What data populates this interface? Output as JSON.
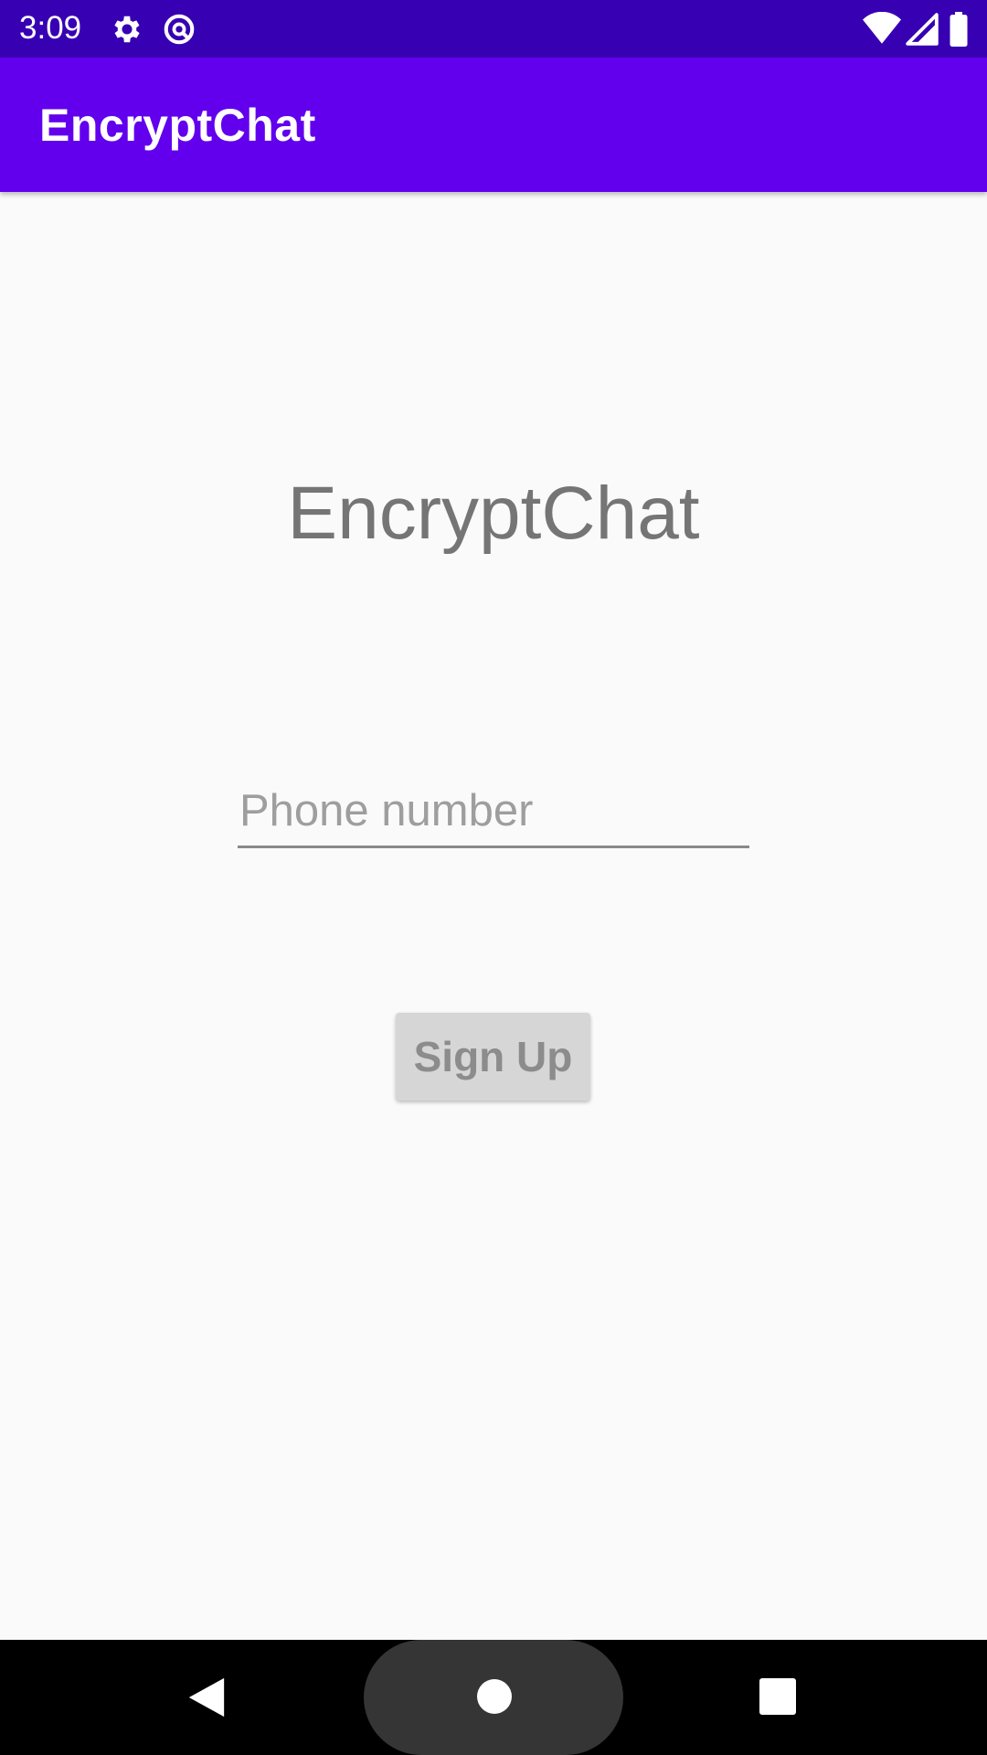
{
  "status_bar": {
    "time": "3:09",
    "icons": [
      "settings-icon",
      "sync-icon",
      "wifi-icon",
      "signal-icon",
      "battery-icon"
    ]
  },
  "app_bar": {
    "title": "EncryptChat",
    "color": "#6200EE"
  },
  "main": {
    "title": "EncryptChat",
    "phone_input": {
      "placeholder": "Phone number",
      "value": ""
    },
    "signup_button_label": "Sign Up"
  },
  "nav_bar": {
    "icons": [
      "back-icon",
      "home-icon",
      "recents-icon"
    ]
  },
  "colors": {
    "status_bar": "#3700B3",
    "background": "#FAFAFA",
    "button_disabled": "#D6D6D6"
  }
}
